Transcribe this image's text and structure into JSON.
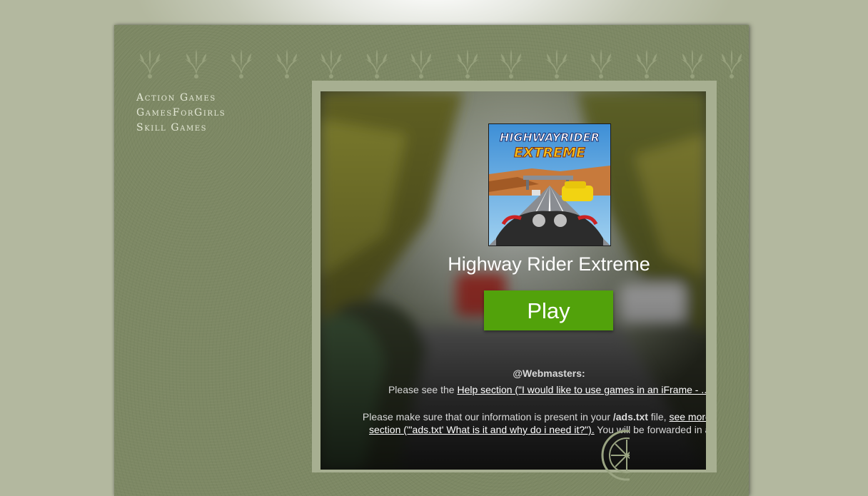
{
  "nav": {
    "items": [
      {
        "label": "Action Games"
      },
      {
        "label": "GamesForGirls"
      },
      {
        "label": "Skill Games"
      }
    ]
  },
  "game": {
    "title": "Highway Rider Extreme",
    "thumb_title_line1": "HIGHWAYRIDER",
    "thumb_title_line2": "EXTREME",
    "play_label": "Play"
  },
  "webmasters": {
    "heading": "@Webmasters:",
    "line1_prefix": "Please see the ",
    "line1_link": "Help section (\"I would like to use games in an iFrame - ...",
    "line2_prefix": "Please make sure that our information is present in your ",
    "line2_bold": "/ads.txt",
    "line2_mid": " file, ",
    "line2_link": "see more detai",
    "line3_link": "section (\"'ads.txt' What is it and why do i need it?\").",
    "line3_suffix": " You will be forwarded in a few"
  },
  "colors": {
    "page_bg": "#7d8864",
    "frame": "#a7af91",
    "play_button": "#52a20b",
    "nav_text": "#e4e8d6"
  }
}
